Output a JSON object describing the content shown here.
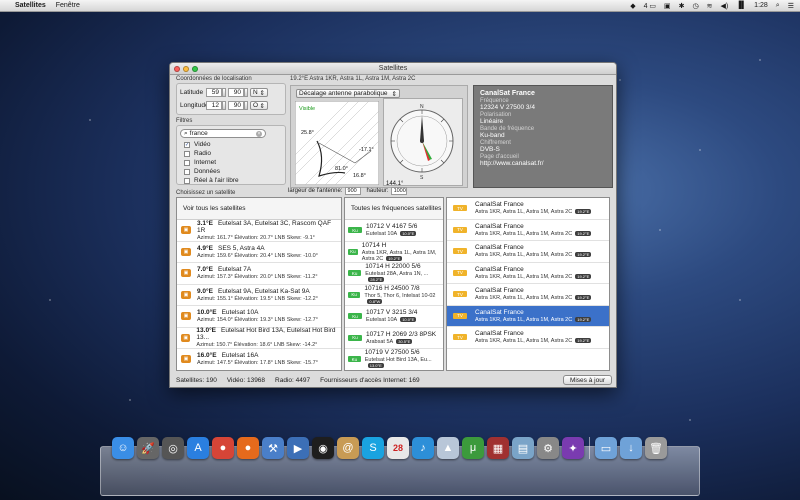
{
  "menubar": {
    "app_name": "Satellites",
    "menu_fenetre": "Fenêtre",
    "battery_label": "4",
    "time": "1:28"
  },
  "window": {
    "title": "Satellites"
  },
  "location": {
    "section_label": "Coordonnées de localisation",
    "latitude_label": "Latitude",
    "latitude_deg": "59",
    "latitude_min": "90",
    "latitude_dir": "N",
    "longitude_label": "Longitude",
    "longitude_deg": "12",
    "longitude_min": "90",
    "longitude_dir": "O"
  },
  "filters": {
    "section_label": "Filtres",
    "search_value": "france",
    "items": [
      {
        "label": "Vidéo",
        "checked": true
      },
      {
        "label": "Radio",
        "checked": false
      },
      {
        "label": "Internet",
        "checked": false
      },
      {
        "label": "Données",
        "checked": false
      },
      {
        "label": "Réel à l'air libre",
        "checked": false
      }
    ]
  },
  "dish": {
    "caption": "19.2°E Astra 1KR, Astra 1L, Astra 1M, Astra 2C",
    "mode_popup": "Décalage antenne parabolique",
    "visible_label": "Visible",
    "angle_1": "25.8°",
    "angle_2": "81.0°",
    "angle_3": "-17.1°",
    "angle_4": "16.8°",
    "compass_value": "144.1°",
    "compass_n": "N",
    "compass_s": "S",
    "antenna_width_label": "largeur de l'antenne:",
    "antenna_width_value": "900",
    "height_label": "hauteur:",
    "height_value": "1000"
  },
  "channel_info": {
    "name": "CanalSat France",
    "freq_key": "Fréquence",
    "freq_value": "12324 V 27500 3/4",
    "pol_key": "Polarisation",
    "pol_value": "Linéaire",
    "band_key": "Bande de fréquence",
    "band_value": "Ku-band",
    "enc_key": "Chiffrement",
    "enc_value": "DVB-S",
    "home_key": "Page d'accueil",
    "home_value": "http://www.canalsat.fr/"
  },
  "choose_label": "Choisissez un satellite",
  "satellites_column": {
    "header": "Voir tous les satellites",
    "rows": [
      {
        "pos": "3.1°E",
        "name": "Eutelsat 3A, Eutelsat 3C, Rascom QAF 1R",
        "details": "Azimut: 161.7°   Élévation: 20.7°   LNB Skew: -9.1°"
      },
      {
        "pos": "4.9°E",
        "name": "SES 5, Astra 4A",
        "details": "Azimut: 159.6°   Élévation: 20.4°   LNB Skew: -10.0°"
      },
      {
        "pos": "7.0°E",
        "name": "Eutelsat 7A",
        "details": "Azimut: 157.3°   Élévation: 20.0°   LNB Skew: -11.2°"
      },
      {
        "pos": "9.0°E",
        "name": "Eutelsat 9A, Eutelsat Ka-Sat 9A",
        "details": "Azimut: 155.1°   Élévation: 19.5°   LNB Skew: -12.2°"
      },
      {
        "pos": "10.0°E",
        "name": "Eutelsat 10A",
        "details": "Azimut: 154.0°   Élévation: 19.3°   LNB Skew: -12.7°"
      },
      {
        "pos": "13.0°E",
        "name": "Eutelsat Hot Bird 13A, Eutelsat Hot Bird 13...",
        "details": "Azimut: 150.7°   Élévation: 18.6°   LNB Skew: -14.2°"
      },
      {
        "pos": "16.0°E",
        "name": "Eutelsat 16A",
        "details": "Azimut: 147.5°   Élévation: 17.8°   LNB Skew: -15.7°"
      }
    ]
  },
  "frequencies_column": {
    "header": "Toutes les fréquences satellites",
    "tag": "Ku",
    "rows": [
      {
        "freq": "10712 V 4167 5/6",
        "sat": "Eutelsat 10A",
        "badge": "10.0°E"
      },
      {
        "freq": "10714 H",
        "sat": "Astra 1KR, Astra 1L, Astra 1M, Astra 2C",
        "badge": "19.2°E"
      },
      {
        "freq": "10714 H 22000 5/6",
        "sat": "Eutelsat 28A, Astra 1N, ...",
        "badge": "28.2°E"
      },
      {
        "freq": "10716 H 24500 7/8",
        "sat": "Thor 5, Thor 6, Intelsat 10-02",
        "badge": "0.8°W"
      },
      {
        "freq": "10717 V 3215 3/4",
        "sat": "Eutelsat 10A",
        "badge": "10.0°E"
      },
      {
        "freq": "10717 H 2069 2/3 8PSK",
        "sat": "Arabsat 5A",
        "badge": "30.5°E"
      },
      {
        "freq": "10719 V 27500 5/6",
        "sat": "Eutelsat Hot Bird 13A, Eu...",
        "badge": "13.0°E"
      }
    ]
  },
  "channels_column": {
    "tag": "TV",
    "rows": [
      {
        "name": "CanalSat France",
        "sat": "Astra 1KR, Astra 1L, Astra 1M, Astra 2C",
        "badge": "19.2°E",
        "selected": false
      },
      {
        "name": "CanalSat France",
        "sat": "Astra 1KR, Astra 1L, Astra 1M, Astra 2C",
        "badge": "19.2°E",
        "selected": false
      },
      {
        "name": "CanalSat France",
        "sat": "Astra 1KR, Astra 1L, Astra 1M, Astra 2C",
        "badge": "19.2°E",
        "selected": false
      },
      {
        "name": "CanalSat France",
        "sat": "Astra 1KR, Astra 1L, Astra 1M, Astra 2C",
        "badge": "19.2°E",
        "selected": false
      },
      {
        "name": "CanalSat France",
        "sat": "Astra 1KR, Astra 1L, Astra 1M, Astra 2C",
        "badge": "19.2°E",
        "selected": false
      },
      {
        "name": "CanalSat France",
        "sat": "Astra 1KR, Astra 1L, Astra 1M, Astra 2C",
        "badge": "19.2°E",
        "selected": true
      },
      {
        "name": "CanalSat France",
        "sat": "Astra 1KR, Astra 1L, Astra 1M, Astra 2C",
        "badge": "19.2°E",
        "selected": false
      }
    ]
  },
  "status": {
    "satellites": "Satellites: 190",
    "video": "Vidéo: 13968",
    "radio": "Radio: 4497",
    "isp": "Fournisseurs d'accès Internet: 169",
    "update_button": "Mises à jour"
  },
  "dock": {
    "icons": [
      {
        "name": "finder-icon",
        "color": "#3a8ee6",
        "glyph": "☺"
      },
      {
        "name": "launchpad-icon",
        "color": "#666",
        "glyph": "🚀"
      },
      {
        "name": "dashboard-icon",
        "color": "#555",
        "glyph": "◎"
      },
      {
        "name": "app-store-icon",
        "color": "#2a7fe0",
        "glyph": "A"
      },
      {
        "name": "chrome-icon",
        "color": "#d64537",
        "glyph": "●"
      },
      {
        "name": "firefox-icon",
        "color": "#e56a1c",
        "glyph": "●"
      },
      {
        "name": "xcode-icon",
        "color": "#4a7fc9",
        "glyph": "⚒"
      },
      {
        "name": "quicktime-icon",
        "color": "#3c6fb6",
        "glyph": "▶"
      },
      {
        "name": "itunes-icon",
        "color": "#1e1e1e",
        "glyph": "◉"
      },
      {
        "name": "contacts-icon",
        "color": "#c89b54",
        "glyph": "@"
      },
      {
        "name": "skype-icon",
        "color": "#1aa3e0",
        "glyph": "S"
      },
      {
        "name": "calendar-icon",
        "color": "#e8e8e8",
        "glyph": "28"
      },
      {
        "name": "music-icon",
        "color": "#2d8fd8",
        "glyph": "♪"
      },
      {
        "name": "vlc-icon",
        "color": "#b8c6d8",
        "glyph": "▲"
      },
      {
        "name": "utorrent-icon",
        "color": "#3c9a3c",
        "glyph": "μ"
      },
      {
        "name": "photo-booth-icon",
        "color": "#a03030",
        "glyph": "▦"
      },
      {
        "name": "preview-icon",
        "color": "#7aa4c8",
        "glyph": "▤"
      },
      {
        "name": "system-preferences-icon",
        "color": "#888",
        "glyph": "⚙"
      },
      {
        "name": "satellites-app-icon",
        "color": "#7a3bb0",
        "glyph": "✦"
      },
      {
        "name": "folder-icon",
        "color": "#6fa2d8",
        "glyph": "▭"
      },
      {
        "name": "downloads-folder-icon",
        "color": "#6fa2d8",
        "glyph": "↓"
      },
      {
        "name": "trash-icon",
        "color": "#9a9a9a",
        "glyph": "🗑"
      }
    ]
  }
}
